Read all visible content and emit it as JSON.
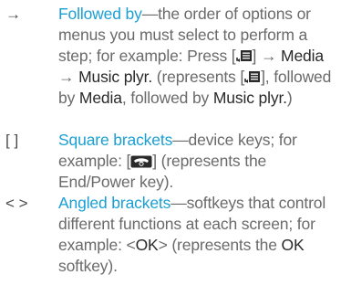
{
  "entries": [
    {
      "symbol": "→",
      "term": "Followed by",
      "dash": "—",
      "text_a": "the order of options or menus you must select to perform a step; for example: Press [",
      "text_b": "] → ",
      "bold_1": "Media",
      "text_c": " → ",
      "bold_2": "Music plyr.",
      "text_d": " (represents [",
      "text_e": "], followed by ",
      "bold_3": "Media",
      "text_f": ", followed by ",
      "bold_4": "Music plyr.",
      "text_g": ")",
      "icon": "menu-key-icon"
    },
    {
      "symbol": "[ ]",
      "term": "Square brackets",
      "dash": "—",
      "text_a": "device keys; for example: [",
      "text_b": "] (represents the End/Power key).",
      "icon": "end-power-key-icon"
    },
    {
      "symbol": "< >",
      "term": "Angled brackets",
      "dash": "—",
      "text_a": "softkeys that control different functions at each screen; for example: <",
      "bold_1": "OK",
      "text_b": "> (represents the ",
      "bold_2": "OK",
      "text_c": " softkey)."
    }
  ],
  "colors": {
    "term": "#1a9fd4",
    "body_text": "#6a6a6a",
    "bold_text": "#2a2a2a"
  }
}
